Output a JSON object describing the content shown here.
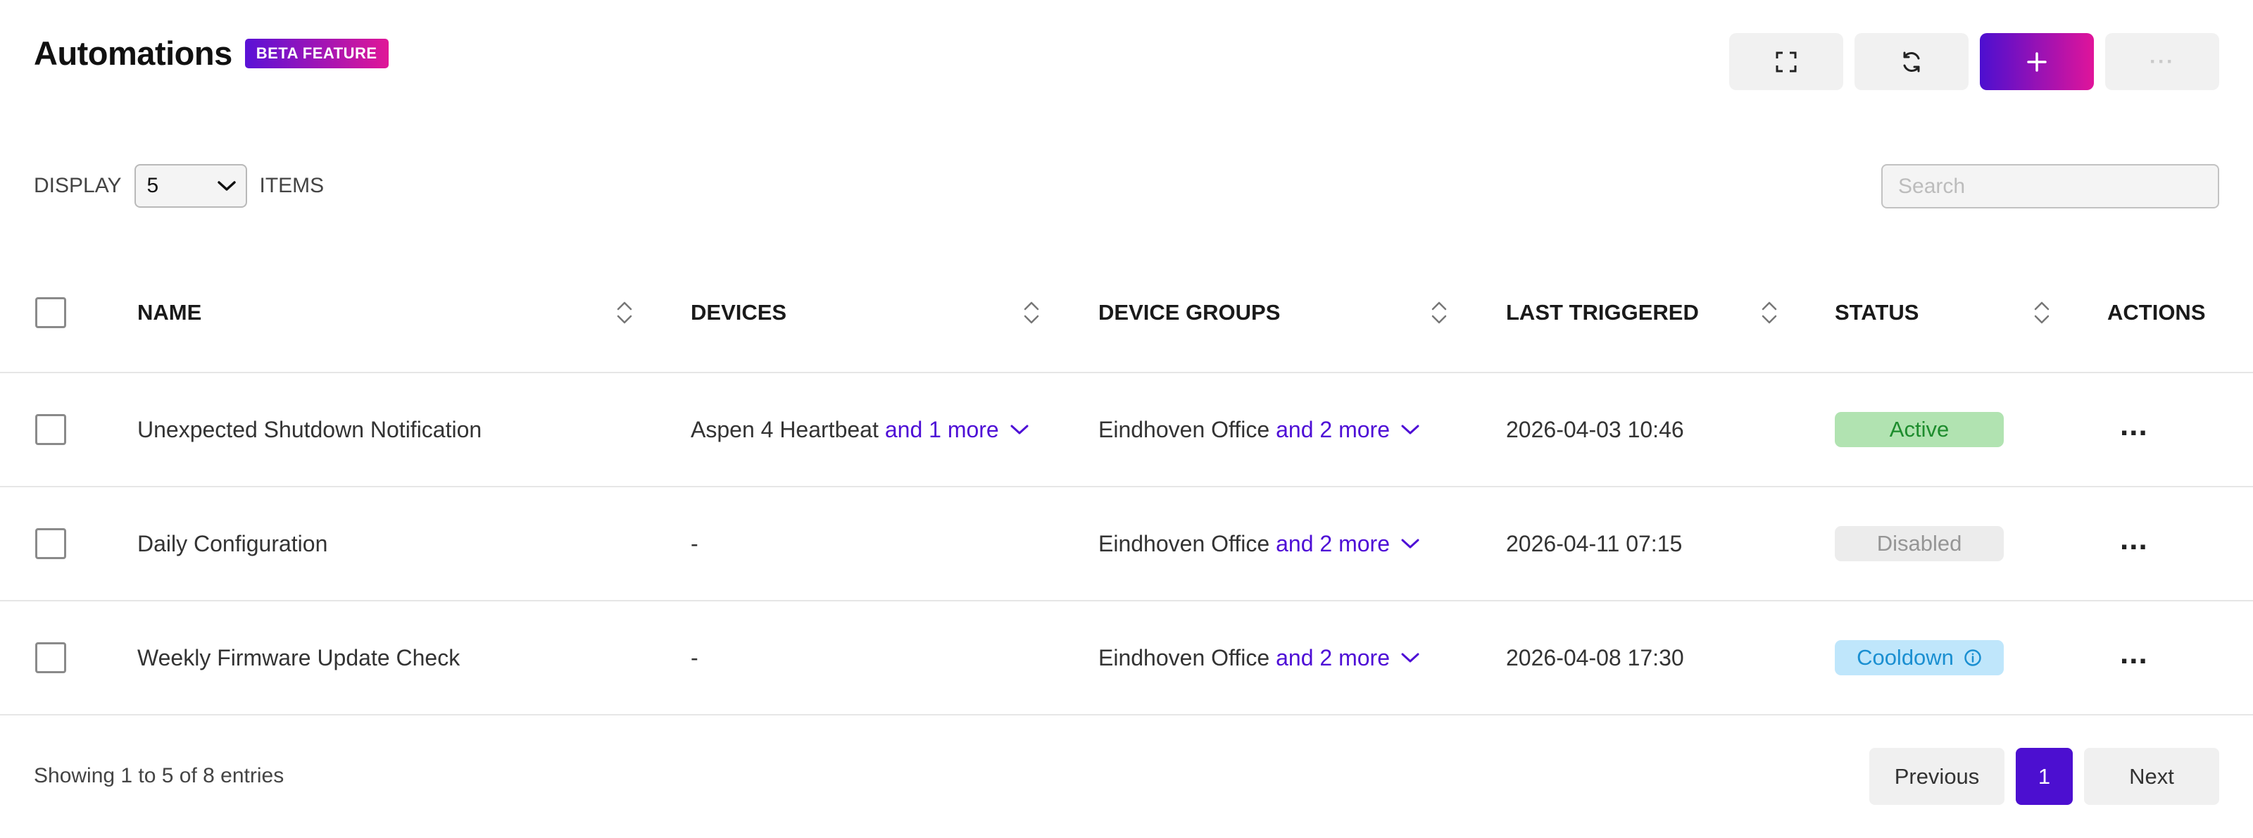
{
  "header": {
    "title": "Automations",
    "badge": "BETA FEATURE"
  },
  "toolbar": {
    "buttons": [
      {
        "icon": "fullscreen-icon"
      },
      {
        "icon": "refresh-icon"
      },
      {
        "icon": "plus-icon"
      },
      {
        "icon": "more-icon",
        "label": "···"
      }
    ]
  },
  "controls": {
    "display_label": "DISPLAY",
    "page_size": "5",
    "items_label": "ITEMS",
    "search_placeholder": "Search"
  },
  "table": {
    "columns": [
      "NAME",
      "DEVICES",
      "DEVICE GROUPS",
      "LAST TRIGGERED",
      "STATUS",
      "ACTIONS"
    ],
    "rows": [
      {
        "name": "Unexpected Shutdown Notification",
        "devices": "Aspen 4 Heartbeat",
        "devices_more": "and 1 more",
        "groups": "Eindhoven Office",
        "groups_more": "and 2 more",
        "last_triggered": "2026-04-03 10:46",
        "status": "Active",
        "actions": "..."
      },
      {
        "name": "Daily Configuration",
        "devices": "-",
        "groups": "Eindhoven Office",
        "groups_more": "and 2 more",
        "last_triggered": "2026-04-11 07:15",
        "status": "Disabled",
        "actions": "..."
      },
      {
        "name": "Weekly Firmware Update Check",
        "devices": "-",
        "groups": "Eindhoven Office",
        "groups_more": "and 2 more",
        "last_triggered": "2026-04-08 17:30",
        "status": "Cooldown",
        "actions": "..."
      }
    ]
  },
  "footer": {
    "entries": "Showing 1 to 5 of 8 entries",
    "prev": "Previous",
    "page": "1",
    "next": "Next"
  },
  "colors": {
    "accent": "#4c0fd0",
    "gradient_end": "#e0149a",
    "active": "#1d8c2d",
    "cooldown": "#1a8fd1"
  }
}
